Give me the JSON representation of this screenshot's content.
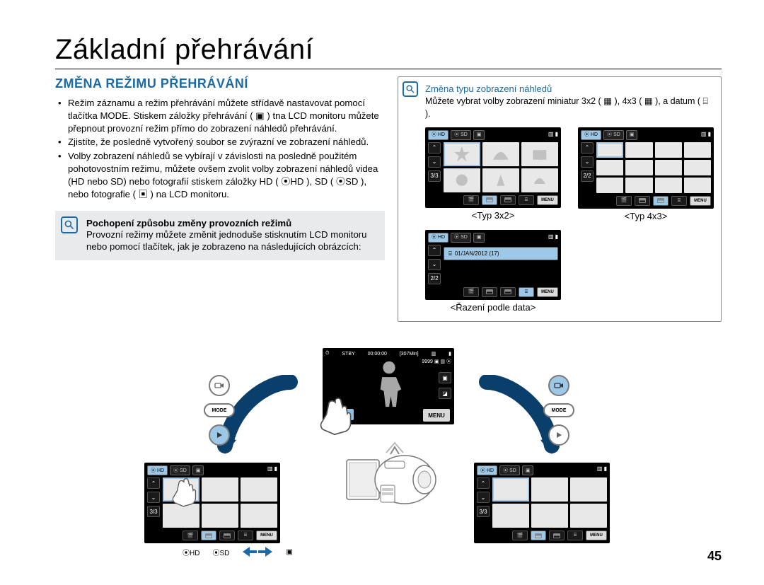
{
  "page": {
    "title": "Základní přehrávání",
    "number": "45"
  },
  "section": {
    "heading": "ZMĚNA REŽIMU PŘEHRÁVÁNÍ"
  },
  "bullets": [
    "Režim záznamu a režim přehrávání můžete střídavě nastavovat pomocí tlačítka MODE. Stiskem záložky přehrávání ( ▣ ) tna LCD monitoru můžete přepnout provozní režim přímo do zobrazení náhledů přehrávání.",
    "Zjistíte, že posledně vytvořený soubor se zvýrazní ve zobrazení náhledů.",
    "Volby zobrazení náhledů se vybírají v závislosti na posledně použitém pohotovostním režimu, můžete ovšem zvolit volby zobrazení náhledů videa (HD nebo SD) nebo fotografií stiskem záložky HD ( ⦿HD ), SD ( ⦿SD ), nebo fotografie ( ▣ ) na LCD monitoru."
  ],
  "tip": {
    "title": "Pochopení způsobu změny provozních režimů",
    "body": "Provozní režimy můžete změnit jednoduše stisknutím LCD monitoru nebo pomocí tlačítek, jak je zobrazeno na následujících obrázcích:"
  },
  "sidebox": {
    "title": "Změna typu zobrazení náhledů",
    "body": "Můžete vybrat volby zobrazení miniatur 3x2 ( ▦ ), 4x3 ( ▦ ), a datum ( ⌸ ).",
    "cap_3x2": "<Typ 3x2>",
    "cap_4x3": "<Typ 4x3>",
    "cap_date": "<Řazení podle data>",
    "date_entry": "01/JAN/2012 (17)"
  },
  "lcd": {
    "hd": "HD",
    "sd": "SD",
    "page_3_3": "3/3",
    "page_2_2": "2/2",
    "menu": "MENU",
    "mode": "MODE",
    "stby": "STBY",
    "time": "00:00:00",
    "remain": "[307Min]",
    "counter": "9999"
  },
  "iconrow": {
    "hd": "HD",
    "sd": "SD"
  }
}
